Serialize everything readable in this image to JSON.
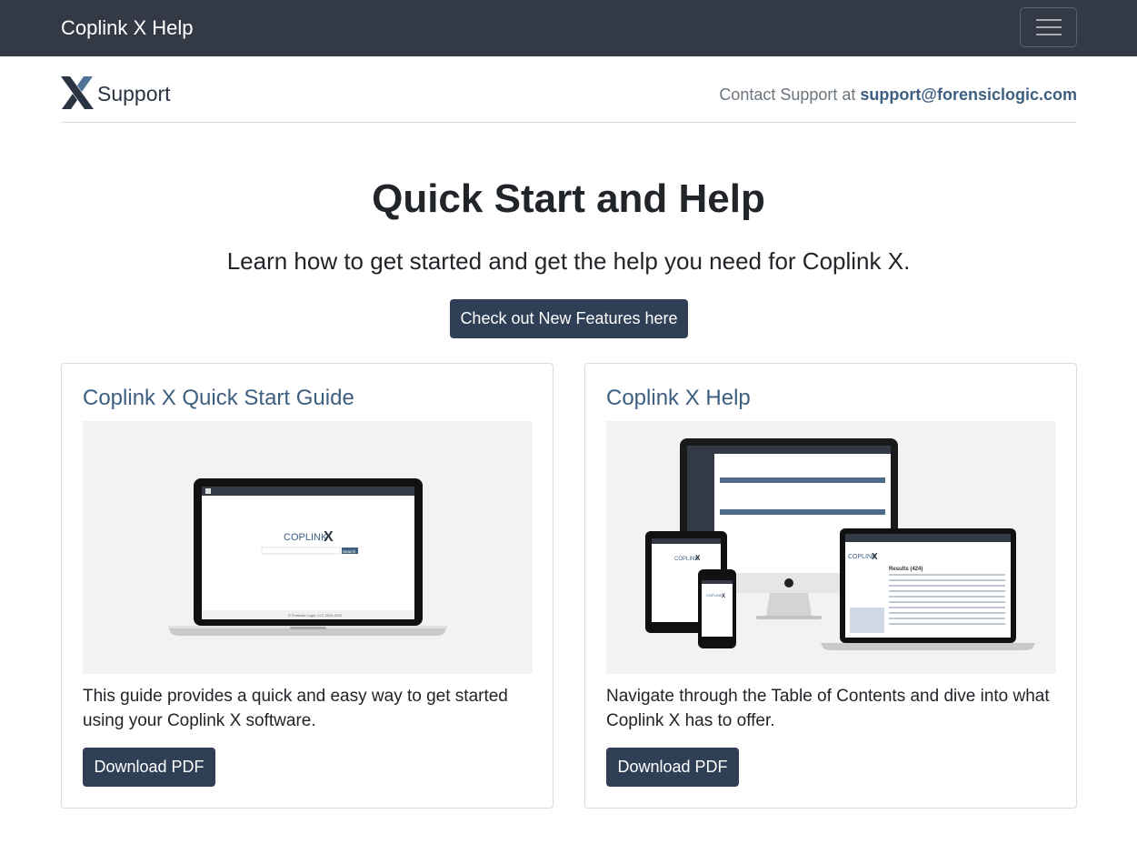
{
  "navbar": {
    "brand": "Coplink X Help",
    "menu_toggle_icon": "hamburger-icon"
  },
  "support_bar": {
    "logo_icon": "coplink-x-logo",
    "label": "Support",
    "contact_prefix": "Contact Support at ",
    "contact_email": "support@forensiclogic.com"
  },
  "hero": {
    "title": "Quick Start and Help",
    "subtitle": "Learn how to get started and get the help you need for Coplink X.",
    "features_button": "Check out New Features here"
  },
  "cards": [
    {
      "title": "Coplink X Quick Start Guide",
      "image_icon": "laptop-screenshot",
      "image_text": {
        "logo": "COPLINK",
        "logo_x": "X",
        "button": "Search",
        "screen_footer": "© Forensic Logic, LLC 2020-2021"
      },
      "text": "This guide provides a quick and easy way to get started using your Coplink X software.",
      "button": "Download PDF"
    },
    {
      "title": "Coplink X Help",
      "image_icon": "multi-device-screenshot",
      "image_text": {
        "logo": "COPLINK",
        "logo_x": "X",
        "results": "Results (424)"
      },
      "text": "Navigate through the Table of Contents and dive into what Coplink X has to offer.",
      "button": "Download PDF"
    }
  ],
  "colors": {
    "navbar_bg": "#343a45",
    "primary_button": "#2f3f56",
    "link": "#3e5f80",
    "muted_text": "#6c757d"
  }
}
